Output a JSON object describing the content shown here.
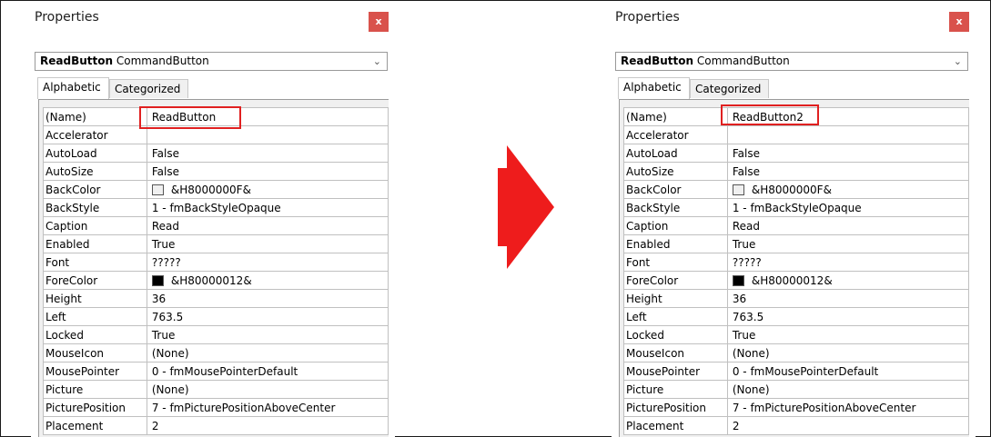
{
  "left_panel": {
    "title": "Properties",
    "close_label": "x",
    "object_name": "ReadButton",
    "object_type": "CommandButton",
    "tabs": [
      "Alphabetic",
      "Categorized"
    ],
    "active_tab": "Alphabetic",
    "rows": [
      {
        "name": "(Name)",
        "value": "ReadButton"
      },
      {
        "name": "Accelerator",
        "value": ""
      },
      {
        "name": "AutoLoad",
        "value": "False"
      },
      {
        "name": "AutoSize",
        "value": "False"
      },
      {
        "name": "BackColor",
        "value": "&H8000000F&"
      },
      {
        "name": "BackStyle",
        "value": "1 - fmBackStyleOpaque"
      },
      {
        "name": "Caption",
        "value": "Read"
      },
      {
        "name": "Enabled",
        "value": "True"
      },
      {
        "name": "Font",
        "value": "?????"
      },
      {
        "name": "ForeColor",
        "value": "&H80000012&"
      },
      {
        "name": "Height",
        "value": "36"
      },
      {
        "name": "Left",
        "value": "763.5"
      },
      {
        "name": "Locked",
        "value": "True"
      },
      {
        "name": "MouseIcon",
        "value": "(None)"
      },
      {
        "name": "MousePointer",
        "value": "0 - fmMousePointerDefault"
      },
      {
        "name": "Picture",
        "value": "(None)"
      },
      {
        "name": "PicturePosition",
        "value": "7 - fmPicturePositionAboveCenter"
      },
      {
        "name": "Placement",
        "value": "2"
      }
    ]
  },
  "right_panel": {
    "title": "Properties",
    "close_label": "x",
    "object_name": "ReadButton",
    "object_type": "CommandButton",
    "tabs": [
      "Alphabetic",
      "Categorized"
    ],
    "active_tab": "Alphabetic",
    "rows": [
      {
        "name": "(Name)",
        "value": "ReadButton2"
      },
      {
        "name": "Accelerator",
        "value": ""
      },
      {
        "name": "AutoLoad",
        "value": "False"
      },
      {
        "name": "AutoSize",
        "value": "False"
      },
      {
        "name": "BackColor",
        "value": "&H8000000F&"
      },
      {
        "name": "BackStyle",
        "value": "1 - fmBackStyleOpaque"
      },
      {
        "name": "Caption",
        "value": "Read"
      },
      {
        "name": "Enabled",
        "value": "True"
      },
      {
        "name": "Font",
        "value": "?????"
      },
      {
        "name": "ForeColor",
        "value": "&H80000012&"
      },
      {
        "name": "Height",
        "value": "36"
      },
      {
        "name": "Left",
        "value": "763.5"
      },
      {
        "name": "Locked",
        "value": "True"
      },
      {
        "name": "MouseIcon",
        "value": "(None)"
      },
      {
        "name": "MousePointer",
        "value": "0 - fmMousePointerDefault"
      },
      {
        "name": "Picture",
        "value": "(None)"
      },
      {
        "name": "PicturePosition",
        "value": "7 - fmPicturePositionAboveCenter"
      },
      {
        "name": "Placement",
        "value": "2"
      }
    ]
  },
  "colors": {
    "highlight": "#e02020",
    "arrow": "#ee1c1c",
    "close_button": "#d9524c",
    "backcolor_swatch": "#f0f0f0",
    "forecolor_swatch": "#000000"
  },
  "icons": {
    "arrow": "right-arrow-icon",
    "dropdown": "chevron-down-icon",
    "close": "close-icon"
  }
}
